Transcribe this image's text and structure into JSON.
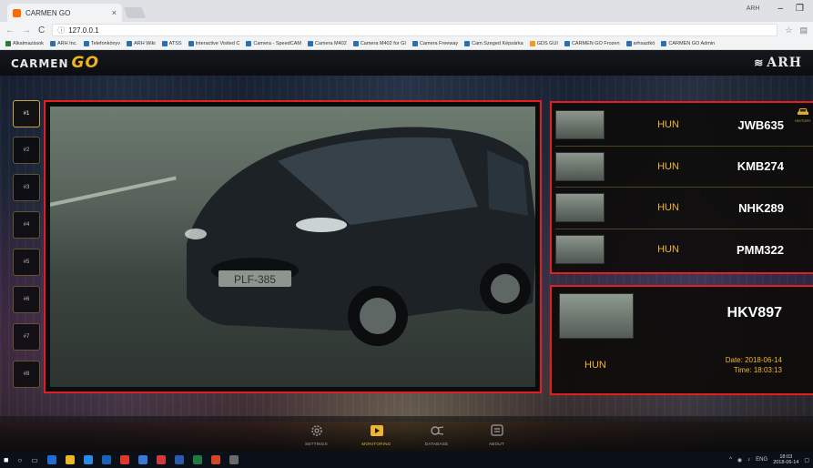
{
  "browser": {
    "tab_title": "CARMEN GO",
    "tab_close": "×",
    "user_label": "ARH",
    "url": "127.0.0.1",
    "nav": {
      "back": "←",
      "forward": "→",
      "reload": "C"
    },
    "bookmarks": [
      {
        "label": "Alkalmazások",
        "icon": "apps"
      },
      {
        "label": "ARH Inc.",
        "icon": "site"
      },
      {
        "label": "Telefonkönyv",
        "icon": "page"
      },
      {
        "label": "ARH Wiki",
        "icon": "site"
      },
      {
        "label": "ATSS",
        "icon": "site"
      },
      {
        "label": "Interactive Visited C",
        "icon": "site"
      },
      {
        "label": "Camera - SpeedCAM",
        "icon": "site"
      },
      {
        "label": "Camera M402",
        "icon": "site"
      },
      {
        "label": "Camera M402 for GI",
        "icon": "site"
      },
      {
        "label": "Camera Freeway",
        "icon": "site"
      },
      {
        "label": "Cam.Szeged Képsárka",
        "icon": "site"
      },
      {
        "label": "GDS GUI",
        "icon": "folder"
      },
      {
        "label": "CARMEN GO Frozen",
        "icon": "site"
      },
      {
        "label": "arhsaztkö",
        "icon": "page"
      },
      {
        "label": "CARMEN GO Admin",
        "icon": "site"
      }
    ]
  },
  "app": {
    "logo_text": "CARMEN",
    "logo_go": "GO",
    "brand": "ARH",
    "camera_tabs": [
      "#1",
      "#2",
      "#3",
      "#4",
      "#5",
      "#6",
      "#7",
      "#8"
    ],
    "active_camera": "#1",
    "video_plate_text": "PLF-385",
    "recent_reads": [
      {
        "country": "HUN",
        "plate": "JWB635"
      },
      {
        "country": "HUN",
        "plate": "KMB274"
      },
      {
        "country": "HUN",
        "plate": "NHK289"
      },
      {
        "country": "HUN",
        "plate": "PMM322"
      }
    ],
    "history_label": "HISTORY",
    "detail": {
      "plate": "HKV897",
      "country": "HUN",
      "date_label": "Date:",
      "date": "2018-06-14",
      "time_label": "Time:",
      "time": "18:03:13"
    },
    "bottom_nav": [
      {
        "label": "SETTINGS",
        "icon": "gear-icon",
        "active": false
      },
      {
        "label": "MONITORING",
        "icon": "play-icon",
        "active": true
      },
      {
        "label": "DATABASE",
        "icon": "database-icon",
        "active": false
      },
      {
        "label": "ABOUT",
        "icon": "info-icon",
        "active": false
      }
    ],
    "colors": {
      "accent": "#f0b530",
      "highlight": "#e41e1e"
    }
  },
  "taskbar": {
    "lang": "ENG",
    "clock_time": "18:03",
    "clock_date": "2018-06-14"
  }
}
